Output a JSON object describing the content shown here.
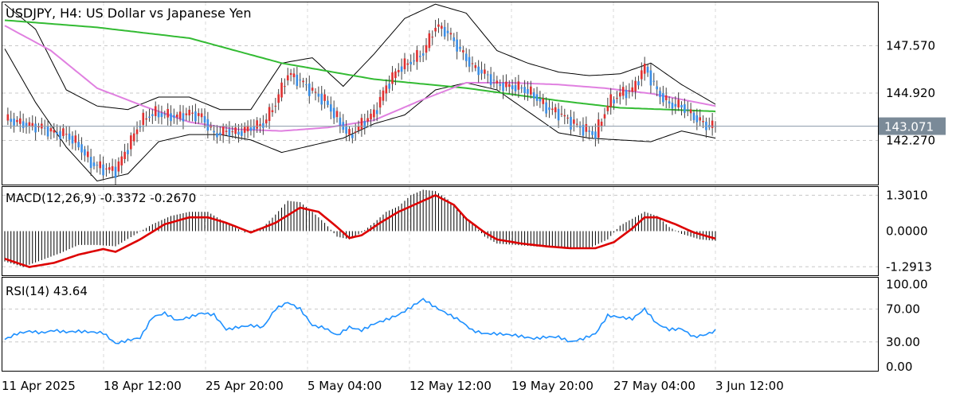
{
  "chart_data": {
    "type": "candlestick",
    "title": "USDJPY, H4:  US Dollar vs Japanese Yen",
    "symbol": "USDJPY",
    "timeframe": "H4",
    "description": "US Dollar vs Japanese Yen",
    "x_tick_labels": [
      "11 Apr 2025",
      "18 Apr 12:00",
      "25 Apr 20:00",
      "5 May 04:00",
      "12 May 12:00",
      "19 May 20:00",
      "27 May 04:00",
      "3 Jun 12:00"
    ],
    "price_panel": {
      "y_tick_labels": [
        "147.570",
        "144.920",
        "142.270"
      ],
      "current_price": "143.071",
      "ylim": [
        139.8,
        150.0
      ],
      "close_points": [
        [
          0,
          143.5
        ],
        [
          4,
          143.3
        ],
        [
          8,
          143.1
        ],
        [
          12,
          143.0
        ],
        [
          16,
          142.7
        ],
        [
          20,
          142.6
        ],
        [
          24,
          142.0
        ],
        [
          28,
          141.0
        ],
        [
          32,
          140.7
        ],
        [
          36,
          140.6
        ],
        [
          40,
          141.9
        ],
        [
          44,
          143.3
        ],
        [
          48,
          143.8
        ],
        [
          52,
          143.7
        ],
        [
          56,
          143.6
        ],
        [
          60,
          143.8
        ],
        [
          64,
          143.6
        ],
        [
          68,
          142.6
        ],
        [
          72,
          142.8
        ],
        [
          76,
          142.7
        ],
        [
          80,
          143.0
        ],
        [
          84,
          143.2
        ],
        [
          88,
          144.4
        ],
        [
          92,
          146.0
        ],
        [
          96,
          145.6
        ],
        [
          100,
          145.0
        ],
        [
          104,
          144.5
        ],
        [
          108,
          143.5
        ],
        [
          112,
          142.5
        ],
        [
          116,
          143.2
        ],
        [
          120,
          143.8
        ],
        [
          124,
          145.3
        ],
        [
          128,
          146.3
        ],
        [
          132,
          146.7
        ],
        [
          136,
          147.2
        ],
        [
          140,
          148.7
        ],
        [
          144,
          148.3
        ],
        [
          148,
          147.3
        ],
        [
          152,
          146.4
        ],
        [
          156,
          146.0
        ],
        [
          160,
          145.4
        ],
        [
          164,
          145.3
        ],
        [
          168,
          145.2
        ],
        [
          172,
          144.8
        ],
        [
          176,
          144.1
        ],
        [
          180,
          143.8
        ],
        [
          184,
          143.3
        ],
        [
          188,
          142.9
        ],
        [
          192,
          142.6
        ],
        [
          196,
          144.3
        ],
        [
          200,
          144.9
        ],
        [
          204,
          145.1
        ],
        [
          208,
          146.4
        ],
        [
          212,
          145.0
        ],
        [
          216,
          144.3
        ],
        [
          220,
          144.2
        ],
        [
          224,
          143.6
        ],
        [
          228,
          143.1
        ],
        [
          231,
          143.07
        ]
      ],
      "moving_averages": [
        {
          "color": "#33bb33",
          "points": [
            [
              0,
              149.0
            ],
            [
              30,
              148.6
            ],
            [
              60,
              148.0
            ],
            [
              90,
              146.6
            ],
            [
              120,
              145.7
            ],
            [
              150,
              145.2
            ],
            [
              180,
              144.5
            ],
            [
              200,
              144.1
            ],
            [
              231,
              143.9
            ]
          ]
        },
        {
          "color": "#e080e0",
          "points": [
            [
              0,
              148.7
            ],
            [
              15,
              147.3
            ],
            [
              30,
              145.2
            ],
            [
              45,
              144.2
            ],
            [
              60,
              143.3
            ],
            [
              75,
              142.9
            ],
            [
              90,
              142.8
            ],
            [
              105,
              143.0
            ],
            [
              120,
              143.4
            ],
            [
              135,
              144.5
            ],
            [
              150,
              145.5
            ],
            [
              165,
              145.5
            ],
            [
              180,
              145.4
            ],
            [
              195,
              145.2
            ],
            [
              210,
              144.9
            ],
            [
              231,
              144.2
            ]
          ]
        }
      ],
      "bollinger_bands": {
        "color": "#000000",
        "upper": [
          [
            0,
            149.9
          ],
          [
            10,
            148.5
          ],
          [
            20,
            145.1
          ],
          [
            30,
            144.2
          ],
          [
            40,
            144.0
          ],
          [
            50,
            144.7
          ],
          [
            60,
            144.7
          ],
          [
            70,
            144.0
          ],
          [
            80,
            144.0
          ],
          [
            90,
            146.6
          ],
          [
            100,
            146.9
          ],
          [
            110,
            145.3
          ],
          [
            120,
            147.1
          ],
          [
            130,
            149.1
          ],
          [
            140,
            149.9
          ],
          [
            150,
            149.4
          ],
          [
            160,
            147.3
          ],
          [
            170,
            146.6
          ],
          [
            180,
            146.1
          ],
          [
            190,
            145.9
          ],
          [
            200,
            146.0
          ],
          [
            210,
            146.6
          ],
          [
            220,
            145.4
          ],
          [
            231,
            144.3
          ]
        ],
        "lower": [
          [
            0,
            147.4
          ],
          [
            10,
            144.4
          ],
          [
            20,
            141.9
          ],
          [
            30,
            140.0
          ],
          [
            40,
            140.4
          ],
          [
            50,
            142.2
          ],
          [
            60,
            142.6
          ],
          [
            70,
            142.6
          ],
          [
            80,
            142.3
          ],
          [
            90,
            141.6
          ],
          [
            100,
            142.0
          ],
          [
            110,
            142.4
          ],
          [
            120,
            143.2
          ],
          [
            130,
            143.7
          ],
          [
            140,
            145.1
          ],
          [
            150,
            145.5
          ],
          [
            160,
            145.1
          ],
          [
            170,
            143.9
          ],
          [
            180,
            142.7
          ],
          [
            190,
            142.4
          ],
          [
            200,
            142.3
          ],
          [
            210,
            142.2
          ],
          [
            220,
            142.8
          ],
          [
            231,
            142.4
          ]
        ]
      }
    },
    "macd_panel": {
      "label": "MACD(12,26,9) -0.3372 -0.2670",
      "y_tick_labels": [
        "1.3010",
        "0.0000",
        "-1.2913"
      ],
      "ylim": [
        -1.6,
        1.6
      ],
      "histogram": [
        [
          0,
          -1.1
        ],
        [
          6,
          -1.3
        ],
        [
          12,
          -1.05
        ],
        [
          18,
          -0.8
        ],
        [
          24,
          -0.5
        ],
        [
          30,
          -0.5
        ],
        [
          36,
          -0.55
        ],
        [
          42,
          -0.15
        ],
        [
          48,
          0.25
        ],
        [
          54,
          0.55
        ],
        [
          60,
          0.7
        ],
        [
          66,
          0.7
        ],
        [
          72,
          0.3
        ],
        [
          78,
          -0.05
        ],
        [
          84,
          0.15
        ],
        [
          88,
          0.6
        ],
        [
          92,
          1.1
        ],
        [
          96,
          1.05
        ],
        [
          100,
          0.7
        ],
        [
          104,
          0.3
        ],
        [
          108,
          -0.2
        ],
        [
          112,
          -0.3
        ],
        [
          116,
          -0.05
        ],
        [
          120,
          0.3
        ],
        [
          124,
          0.7
        ],
        [
          128,
          0.9
        ],
        [
          132,
          1.3
        ],
        [
          136,
          1.5
        ],
        [
          140,
          1.45
        ],
        [
          144,
          1.15
        ],
        [
          148,
          0.7
        ],
        [
          152,
          0.3
        ],
        [
          156,
          -0.2
        ],
        [
          160,
          -0.45
        ],
        [
          166,
          -0.5
        ],
        [
          172,
          -0.55
        ],
        [
          178,
          -0.6
        ],
        [
          184,
          -0.62
        ],
        [
          190,
          -0.62
        ],
        [
          196,
          -0.3
        ],
        [
          200,
          0.2
        ],
        [
          204,
          0.45
        ],
        [
          208,
          0.7
        ],
        [
          212,
          0.55
        ],
        [
          216,
          0.15
        ],
        [
          220,
          -0.1
        ],
        [
          226,
          -0.3
        ],
        [
          231,
          -0.35
        ]
      ],
      "macd_line_color": "#dd0000",
      "signal_line": [
        [
          0,
          -1.0
        ],
        [
          8,
          -1.3
        ],
        [
          16,
          -1.15
        ],
        [
          24,
          -0.85
        ],
        [
          32,
          -0.65
        ],
        [
          36,
          -0.75
        ],
        [
          44,
          -0.3
        ],
        [
          52,
          0.25
        ],
        [
          60,
          0.5
        ],
        [
          66,
          0.5
        ],
        [
          72,
          0.3
        ],
        [
          80,
          -0.05
        ],
        [
          88,
          0.3
        ],
        [
          96,
          0.85
        ],
        [
          102,
          0.7
        ],
        [
          108,
          0.15
        ],
        [
          112,
          -0.25
        ],
        [
          116,
          -0.15
        ],
        [
          122,
          0.3
        ],
        [
          128,
          0.7
        ],
        [
          134,
          1.0
        ],
        [
          140,
          1.3
        ],
        [
          146,
          0.95
        ],
        [
          150,
          0.45
        ],
        [
          156,
          -0.05
        ],
        [
          160,
          -0.3
        ],
        [
          168,
          -0.45
        ],
        [
          176,
          -0.55
        ],
        [
          184,
          -0.62
        ],
        [
          192,
          -0.62
        ],
        [
          198,
          -0.4
        ],
        [
          204,
          0.1
        ],
        [
          208,
          0.5
        ],
        [
          212,
          0.5
        ],
        [
          218,
          0.25
        ],
        [
          224,
          -0.05
        ],
        [
          231,
          -0.27
        ]
      ]
    },
    "rsi_panel": {
      "label": "RSI(14) 43.64",
      "y_tick_labels": [
        "100.00",
        "70.00",
        "30.00",
        "0.00"
      ],
      "ylim": [
        -5,
        108
      ],
      "levels": [
        70,
        30
      ],
      "series": [
        {
          "color": "#1e90ff",
          "points": [
            [
              0,
              33
            ],
            [
              4,
              40
            ],
            [
              8,
              43
            ],
            [
              12,
              41
            ],
            [
              16,
              44
            ],
            [
              20,
              42
            ],
            [
              24,
              43
            ],
            [
              28,
              42
            ],
            [
              32,
              41
            ],
            [
              36,
              28
            ],
            [
              40,
              32
            ],
            [
              44,
              35
            ],
            [
              48,
              60
            ],
            [
              52,
              65
            ],
            [
              56,
              56
            ],
            [
              60,
              60
            ],
            [
              64,
              65
            ],
            [
              68,
              63
            ],
            [
              72,
              45
            ],
            [
              76,
              48
            ],
            [
              80,
              50
            ],
            [
              84,
              48
            ],
            [
              88,
              70
            ],
            [
              92,
              78
            ],
            [
              96,
              70
            ],
            [
              100,
              50
            ],
            [
              104,
              47
            ],
            [
              108,
              38
            ],
            [
              112,
              48
            ],
            [
              116,
              44
            ],
            [
              120,
              52
            ],
            [
              124,
              57
            ],
            [
              128,
              63
            ],
            [
              132,
              72
            ],
            [
              136,
              82
            ],
            [
              140,
              72
            ],
            [
              144,
              64
            ],
            [
              148,
              56
            ],
            [
              152,
              44
            ],
            [
              156,
              40
            ],
            [
              160,
              40
            ],
            [
              166,
              38
            ],
            [
              172,
              34
            ],
            [
              176,
              36
            ],
            [
              180,
              36
            ],
            [
              184,
              30
            ],
            [
              188,
              34
            ],
            [
              192,
              40
            ],
            [
              196,
              62
            ],
            [
              200,
              60
            ],
            [
              204,
              58
            ],
            [
              208,
              70
            ],
            [
              212,
              52
            ],
            [
              216,
              45
            ],
            [
              220,
              46
            ],
            [
              224,
              36
            ],
            [
              228,
              39
            ],
            [
              231,
              43.64
            ]
          ]
        }
      ]
    }
  }
}
